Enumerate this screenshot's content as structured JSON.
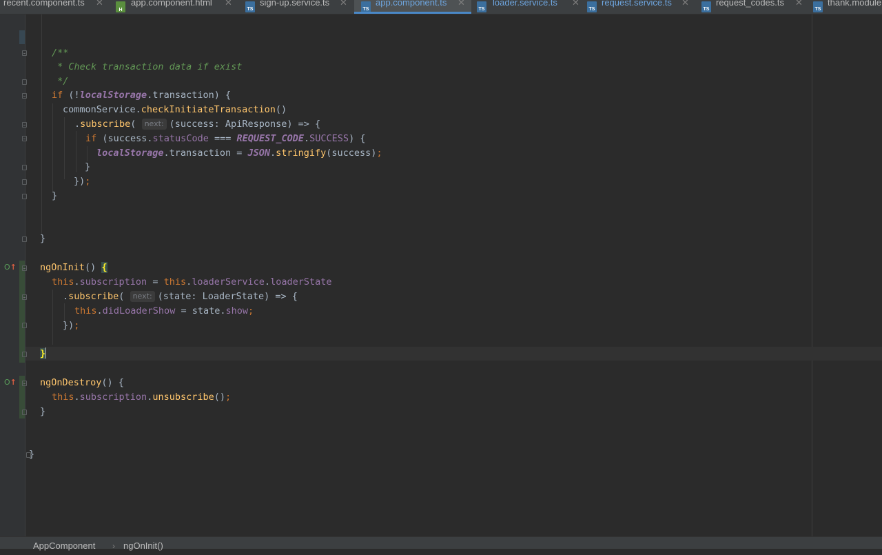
{
  "tabs": [
    {
      "name": "recent.component.ts",
      "type": "ts",
      "active": false
    },
    {
      "name": "app.component.html",
      "type": "html",
      "active": false
    },
    {
      "name": "sign-up.service.ts",
      "type": "ts",
      "active": false
    },
    {
      "name": "app.component.ts",
      "type": "ts",
      "active": true
    },
    {
      "name": "loader.service.ts",
      "type": "ts",
      "active": false
    },
    {
      "name": "request.service.ts",
      "type": "ts",
      "active": false
    },
    {
      "name": "request_codes.ts",
      "type": "ts",
      "active": false
    },
    {
      "name": "thank.module",
      "type": "ts",
      "active": false
    }
  ],
  "icons": {
    "ts_file": "TS",
    "html_file": "H",
    "close": "✕",
    "override_circle": "O",
    "override_arrow": "↑",
    "breadcrumb_separator": "›"
  },
  "code": {
    "c1": "/**",
    "c2": " * Check transaction data if exist",
    "c3": " */",
    "l4_kw": "if",
    "l4_a": " (!",
    "l4_gl": "localStorage",
    "l4_b": ".transaction) {",
    "l5_a": "commonService.",
    "l5_fn": "checkInitiateTransaction",
    "l5_b": "()",
    "l6_a": ".",
    "l6_fn": "subscribe",
    "l6_b": "(",
    "l6_hint": "next:",
    "l6_c": "(success: ApiResponse) => {",
    "l7_kw": "if",
    "l7_a": " (success.",
    "l7_prop": "statusCode",
    "l7_b": " === ",
    "l7_gl": "REQUEST_CODE",
    "l7_c": ".",
    "l7_prop2": "SUCCESS",
    "l7_d": ") {",
    "l8_gl": "localStorage",
    "l8_a": ".transaction = ",
    "l8_gl2": "JSON",
    "l8_b": ".",
    "l8_fn": "stringify",
    "l8_c": "(success)",
    "l8_semi": ";",
    "l9": "}",
    "l10_a": "})",
    "l10_semi": ";",
    "l11": "}",
    "l12": "}",
    "l13_fn": "ngOnInit",
    "l13_a": "() ",
    "l13_brace": "{",
    "l14_kw": "this",
    "l14_a": ".",
    "l14_prop": "subscription",
    "l14_b": " = ",
    "l14_kw2": "this",
    "l14_c": ".",
    "l14_prop2": "loaderService",
    "l14_d": ".",
    "l14_prop3": "loaderState",
    "l15_a": ".",
    "l15_fn": "subscribe",
    "l15_b": "(",
    "l15_hint": "next:",
    "l15_c": "(state: LoaderState) => {",
    "l16_kw": "this",
    "l16_a": ".",
    "l16_prop": "didLoaderShow",
    "l16_b": " = state.",
    "l16_prop2": "show",
    "l16_semi": ";",
    "l17_a": "})",
    "l17_semi": ";",
    "l18_brace": "}",
    "l19_fn": "ngOnDestroy",
    "l19_a": "() {",
    "l20_kw": "this",
    "l20_a": ".",
    "l20_prop": "subscription",
    "l20_b": ".",
    "l20_fn": "unsubscribe",
    "l20_c": "()",
    "l20_semi": ";",
    "l21": "}",
    "l22": "}"
  },
  "breadcrumb": {
    "class_name": "AppComponent",
    "method_name": "ngOnInit()"
  },
  "colors": {
    "editor_bg": "#2b2b2b",
    "keyword": "#cc7832",
    "function": "#ffc66d",
    "property": "#9876aa",
    "comment": "#629755",
    "text": "#a9b7c6",
    "active_tab_text": "#6ea6e0"
  }
}
